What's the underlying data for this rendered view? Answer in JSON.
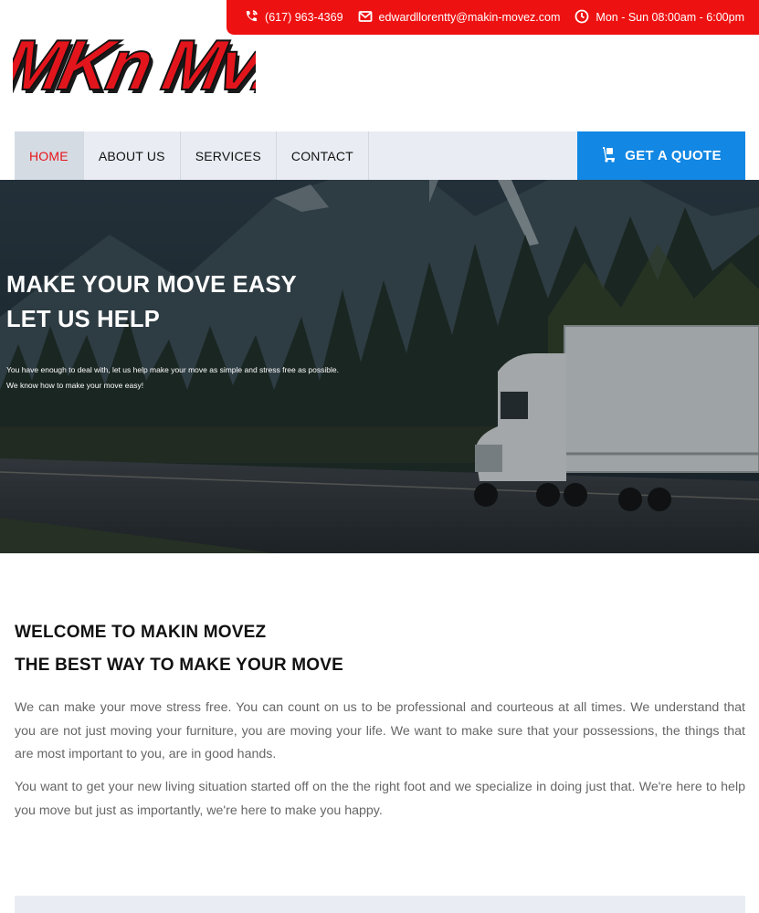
{
  "topbar": {
    "phone": "(617) 963-4369",
    "email": "edwardllorentty@makin-movez.com",
    "hours": "Mon - Sun 08:00am - 6:00pm"
  },
  "logo": {
    "text": "MKN MVZ"
  },
  "nav": {
    "items": [
      {
        "label": "HOME",
        "active": true
      },
      {
        "label": "ABOUT US",
        "active": false
      },
      {
        "label": "SERVICES",
        "active": false
      },
      {
        "label": "CONTACT",
        "active": false
      }
    ],
    "quote_label": "GET A QUOTE"
  },
  "hero": {
    "title_line1": "MAKE YOUR MOVE EASY",
    "title_line2": "LET US HELP",
    "sub_line1": "You have enough to deal with, let us help make your move as simple and stress free as possible.",
    "sub_line2": "We know how to make your move easy!"
  },
  "welcome": {
    "title_line1": "WELCOME TO MAKIN MOVEZ",
    "title_line2": "THE BEST WAY TO MAKE YOUR MOVE",
    "paragraph1": "We can make your move stress free. You can count on us to be professional and courteous at all times. We understand that you are not just moving your furniture, you are moving your life. We want to make sure that your possessions, the things that are most important to you, are in good hands.",
    "paragraph2": "You want to get your new living situation started off on the the right foot and we specialize in doing just that. We're here to help you move but just as importantly, we're here to make you happy."
  },
  "colors": {
    "brand_red": "#ee1111",
    "quote_blue": "#1287e3",
    "nav_bg": "#e9edf3"
  },
  "icons": [
    "phone-icon",
    "mail-icon",
    "clock-icon",
    "hand-truck-icon"
  ]
}
